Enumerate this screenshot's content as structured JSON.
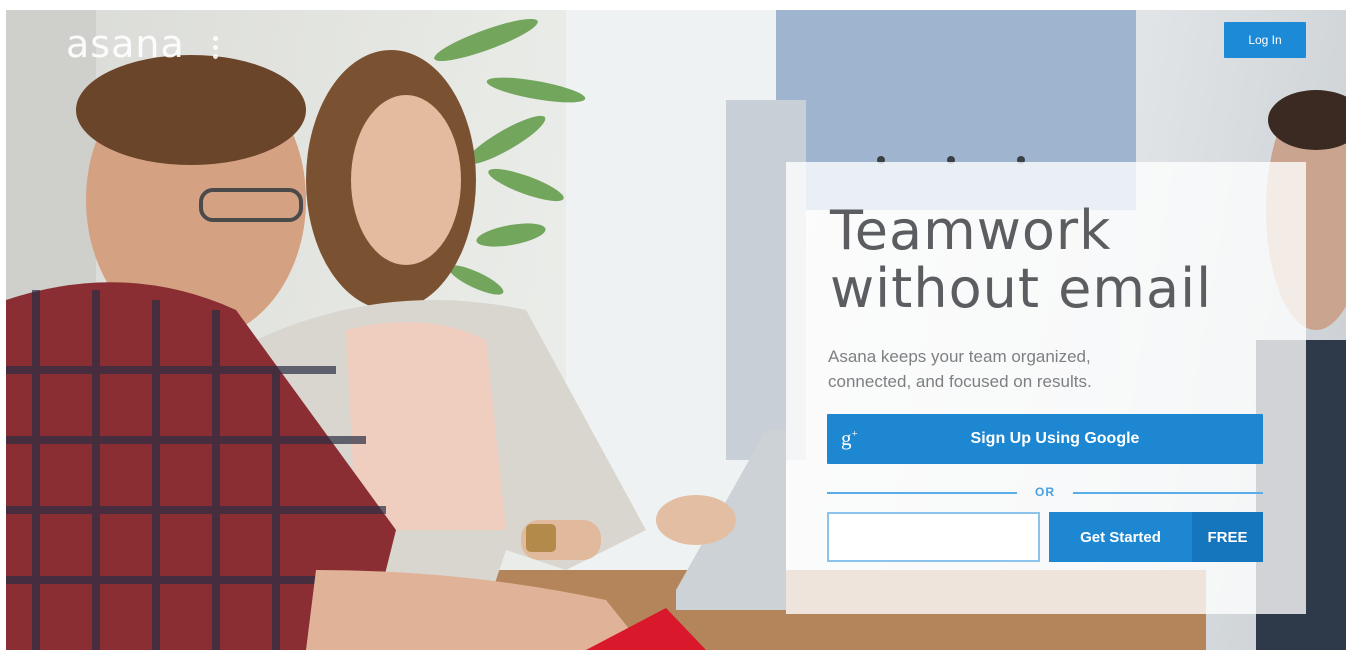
{
  "brand": {
    "logo_text": "asana"
  },
  "header": {
    "login_label": "Log In"
  },
  "hero": {
    "headline_line1": "Teamwork",
    "headline_line2": "without email",
    "subhead_line1": "Asana keeps your team organized,",
    "subhead_line2": "connected, and focused on results."
  },
  "signup": {
    "google_icon_text": "g",
    "google_icon_sup": "+",
    "google_label": "Sign Up Using Google",
    "or_label": "OR",
    "email_value": "",
    "get_started_label": "Get Started",
    "free_label": "FREE"
  },
  "colors": {
    "accent": "#1e87d2",
    "accent_dark": "#1576bd",
    "headline": "#5b5d60",
    "subhead": "#7d7f82"
  },
  "icons": [
    "google-plus-icon"
  ]
}
